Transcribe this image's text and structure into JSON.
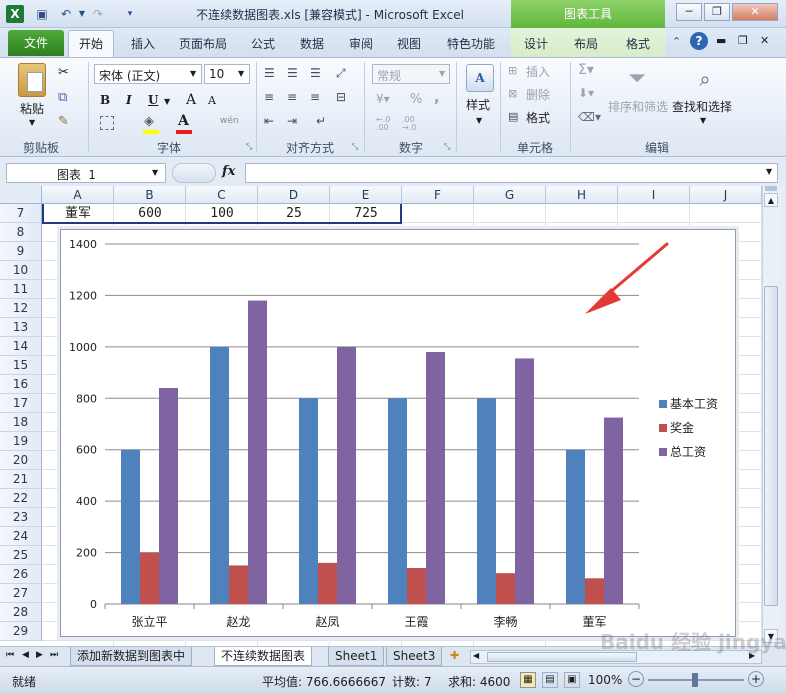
{
  "title_bar": {
    "title": "不连续数据图表.xls  [兼容模式] - Microsoft Excel",
    "context_tab_group": "图表工具",
    "app_icon": "excel-icon",
    "qat_icons": [
      "save-icon",
      "undo-icon",
      "redo-icon",
      "customize-qat-icon"
    ],
    "window_buttons": [
      "minimize-icon",
      "restore-icon",
      "close-icon"
    ]
  },
  "tabs": {
    "file": "文件",
    "home": "开始",
    "insert": "插入",
    "page_layout": "页面布局",
    "formulas": "公式",
    "data": "数据",
    "review": "审阅",
    "view": "视图",
    "special": "特色功能",
    "design": "设计",
    "layout": "布局",
    "format": "格式"
  },
  "ribbon": {
    "clipboard": {
      "paste": "粘贴",
      "label": "剪贴板"
    },
    "font": {
      "name": "宋体 (正文)",
      "size": "10",
      "bold": "B",
      "italic": "I",
      "underline": "U",
      "grow": "A",
      "shrink": "A",
      "font_color": "A",
      "phonetic": "wén",
      "label": "字体"
    },
    "alignment": {
      "label": "对齐方式"
    },
    "number": {
      "format": "常规",
      "percent": "%",
      "comma": ",",
      "label": "数字"
    },
    "styles": {
      "label": "样式"
    },
    "cells": {
      "insert": "插入",
      "delete": "删除",
      "format": "格式",
      "label": "单元格"
    },
    "editing": {
      "sort_filter": "排序和筛选",
      "find_select": "查找和选择",
      "label": "编辑"
    }
  },
  "formula_bar": {
    "name_box": "图表 1",
    "fx": "fx",
    "formula": ""
  },
  "columns": [
    "A",
    "B",
    "C",
    "D",
    "E",
    "F",
    "G",
    "H",
    "I",
    "J"
  ],
  "rows": [
    "7",
    "8",
    "9",
    "10",
    "11",
    "12",
    "13",
    "14",
    "15",
    "16",
    "17",
    "18",
    "19",
    "20",
    "21",
    "22",
    "23",
    "24",
    "25",
    "26",
    "27",
    "28",
    "29"
  ],
  "row7_cells": [
    "董军",
    "600",
    "100",
    "25",
    "725"
  ],
  "chart_data": {
    "type": "bar",
    "categories": [
      "张立平",
      "赵龙",
      "赵凤",
      "王霞",
      "李畅",
      "董军"
    ],
    "series": [
      {
        "name": "基本工资",
        "color": "#4f81bd",
        "values": [
          600,
          1000,
          800,
          800,
          800,
          600
        ]
      },
      {
        "name": "奖金",
        "color": "#c0504d",
        "values": [
          200,
          150,
          160,
          140,
          120,
          100
        ]
      },
      {
        "name": "总工资",
        "color": "#8064a2",
        "values": [
          840,
          1180,
          1000,
          980,
          955,
          725
        ]
      }
    ],
    "yticks": [
      "0",
      "200",
      "400",
      "600",
      "800",
      "1000",
      "1200",
      "1400"
    ],
    "ylim": [
      0,
      1400
    ],
    "grid": true,
    "legend": "right",
    "annotation": "red-arrow",
    "annotation_color": "#e53935"
  },
  "sheet_tabs": [
    "添加新数据到图表中",
    "不连续数据图表",
    "Sheet1",
    "Sheet3"
  ],
  "status": {
    "ready": "就绪",
    "average": "平均值: 766.6666667",
    "count": "计数: 7",
    "sum": "求和: 4600",
    "zoom": "100%"
  },
  "watermark": "Baidu 经验 jingyan.baidu.com"
}
